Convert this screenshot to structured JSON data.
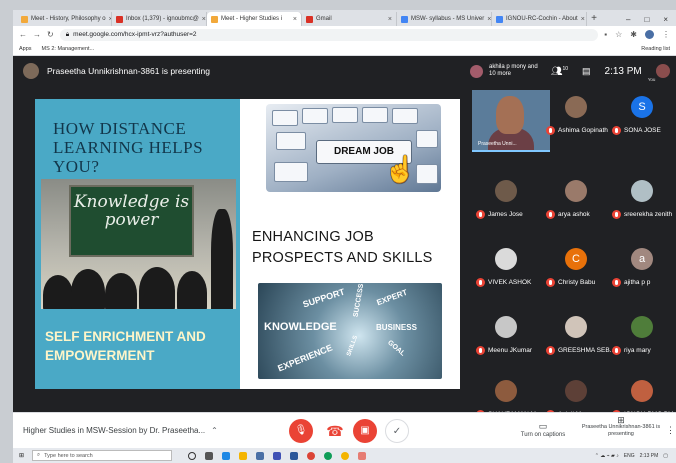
{
  "browser": {
    "tabs": [
      {
        "label": "Meet - History, Philosophy o",
        "color": "#f2a93b"
      },
      {
        "label": "Inbox (1,379) - ignoubmc@",
        "color": "#d93025"
      },
      {
        "label": "Meet - Higher Studies i",
        "color": "#f2a93b",
        "active": true
      },
      {
        "label": "Gmail",
        "color": "#d93025"
      },
      {
        "label": "MSW- syllabus - MS Univer",
        "color": "#4285f4"
      },
      {
        "label": "IGNOU-RC-Cochin - About",
        "color": "#4285f4"
      }
    ],
    "new_tab": "+",
    "window_controls": [
      "–",
      "□",
      "×"
    ],
    "url": "meet.google.com/hcx-ipmt-vrz?authuser=2",
    "bookmarks": [
      "Apps",
      "MS 2: Management..."
    ],
    "reading_list": "Reading list"
  },
  "meet": {
    "presenter_text": "Praseetha Unnikrishnan-3861 is presenting",
    "participants_summary": "akhila p mony and 10 more",
    "people_count": "10",
    "chat_count": "",
    "time": "2:13 PM",
    "you_label": "You",
    "self_name": "Praseetha Unni...",
    "participants": [
      {
        "name": "Ashima Gopinath",
        "avatar_color": "#8a6a55",
        "initial": ""
      },
      {
        "name": "SONA JOSE",
        "avatar_color": "#1a73e8",
        "initial": "S"
      },
      {
        "name": "James Jose",
        "avatar_color": "#6e5a4a",
        "initial": ""
      },
      {
        "name": "arya ashok",
        "avatar_color": "#9a7a6a",
        "initial": ""
      },
      {
        "name": "sreerekha zenith",
        "avatar_color": "#b0bfc5",
        "initial": ""
      },
      {
        "name": "VIVEK ASHOK",
        "avatar_color": "#dadada",
        "initial": ""
      },
      {
        "name": "Christy Babu",
        "avatar_color": "#e8710a",
        "initial": "C"
      },
      {
        "name": "ajitha p p",
        "avatar_color": "#a1887f",
        "initial": "a"
      },
      {
        "name": "Meenu JKumar",
        "avatar_color": "#c7c7c7",
        "initial": ""
      },
      {
        "name": "GREESHMA SEB...",
        "avatar_color": "#d0c4b9",
        "initial": ""
      },
      {
        "name": "riya mary",
        "avatar_color": "#4f7d3a",
        "initial": ""
      },
      {
        "name": "SHAHZAMAN M...",
        "avatar_color": "#8d5b3e",
        "initial": ""
      },
      {
        "name": "Anjali M",
        "avatar_color": "#5d4037",
        "initial": ""
      },
      {
        "name": "IGNOU-BMC BM",
        "avatar_color": "#c06040",
        "initial": ""
      }
    ]
  },
  "slide": {
    "left_title": "HOW DISTANCE LEARNING HELPS YOU?",
    "board_text": "Knowledge is power",
    "left_subtitle": "SELF ENRICHMENT AND EMPOWERMENT",
    "key_text": "DREAM JOB",
    "right_title": "ENHANCING JOB PROSPECTS AND SKILLS",
    "cloud_words": [
      "SUPPORT",
      "SUCCESS",
      "EXPERT",
      "KNOWLEDGE",
      "BUSINESS",
      "EXPERIENCE",
      "SKILLS",
      "GOAL"
    ]
  },
  "bottom": {
    "meeting_title": "Higher Studies in MSW-Session by Dr. Praseetha...",
    "captions_label": "Turn on captions",
    "presenting_label": "Praseetha Unnikrishnan-3861 is presenting"
  },
  "taskbar": {
    "search_placeholder": "Type here to search",
    "time": "2:13 PM",
    "date": "",
    "lang": "ENG"
  },
  "colors": {
    "meet_bg": "#202124",
    "slide_blue": "#4aa9c6",
    "end_call_red": "#ea4335"
  }
}
